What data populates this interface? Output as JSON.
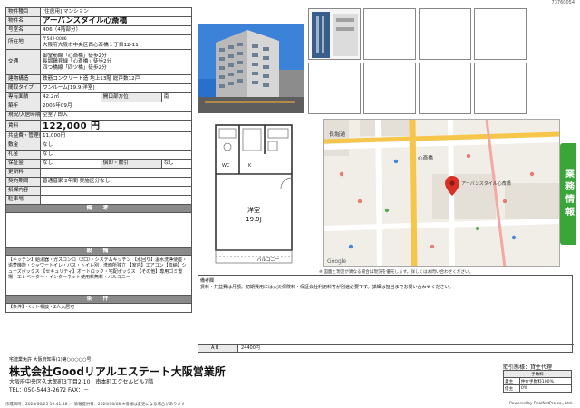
{
  "doc_id": "73760054",
  "spec": {
    "type_label": "物件種目",
    "type_value": "[住居用] マンション",
    "name_label": "物件名",
    "name_value": "アーバンスタイル心斎橋",
    "room_label": "号室名",
    "room_value": "406（4階部分）",
    "address_label": "所在地",
    "address_zip": "〒542-0086",
    "address_value": "大阪府大阪市中央区西心斎橋１丁目12-11",
    "traffic_label": "交通",
    "traffic_lines": [
      "御堂筋線「心斎橋」徒歩2分",
      "長堀鶴見緑「心斎橋」徒歩2分",
      "四つ橋線「四ツ橋」徒歩2分"
    ],
    "structure_label": "建物構造",
    "structure_value": "鉄筋コンクリート造 地上13階 総戸数12戸",
    "layout_label": "間取タイプ",
    "layout_value": "ワンルーム[19.9 洋室]",
    "area_label": "専有面積",
    "area_value": "42.2㎡",
    "direction_label": "開口部方位",
    "direction_value": "南",
    "built_label": "築年",
    "built_value": "2005年09月",
    "status_label": "現況/入居時期",
    "status_value": "空室 / 即入",
    "rent_label": "賃料",
    "rent_value": "122,000 円",
    "fee_label": "共益費・管理費",
    "fee_value": "11,000円",
    "deposit_label": "敷金",
    "deposit_value": "なし",
    "keymoney_label": "礼金",
    "keymoney_value": "なし",
    "guarantee_label": "保証金",
    "guarantee_value": "なし",
    "amort_label": "償却・敷引",
    "amort_value": "なし",
    "renewal_label": "更新料",
    "renewal_value": "",
    "contract_label": "契約期間",
    "contract_value": "普通借家 2年間 実施区分なし",
    "insurance_label": "損保内容",
    "insurance_value": "",
    "parking_label": "駐車場",
    "parking_value": "",
    "remarks_header": "備　考",
    "equipment_header": "設　備",
    "equipment_text": "【キッチン】給湯器・ガスコンロ（2口）・システムキッチン 【水回り】温水洗浄便座・追焚機能・シャワートイレ・バス・トイレ別・洗面所独立 【室内】エアコン【収納】シューズボックス 【セキュリティ】オートロック・宅配ボックス 【その他】専用ゴミ置場・エレベーター・インターネット使用料無料・バルコニー",
    "conditions_header": "条　件",
    "conditions_text": "【条件】ペット相談・2人入居可"
  },
  "map": {
    "labels": [
      "長堀通",
      "心斎橋",
      "アーバンスタイル心斎橋",
      "Google"
    ]
  },
  "floorplan": {
    "room_label": "洋室",
    "room_size": "19.9J",
    "balcony": "バルコニー"
  },
  "disclaimer": "※ 図面と現況が異なる場合は現況を優先します。詳しくはお問い合わせください。",
  "remarks": {
    "label": "備考欄",
    "text": "賃料・共益費は月額。初期費用には火災保険料・保証会社利用料等が別途必要です。詳細は担当までお問い合わせください。",
    "code_label": "A B",
    "code_value": "24400円"
  },
  "side_tab": "業務情報",
  "footer": {
    "license": "宅建業免許 大阪府知事(1)第○○○○○号",
    "company": "株式会社Goodリアルエステート大阪営業所",
    "address": "大阪府中央区久太郎町3丁目2-10　南本町エクセルビル7階",
    "tel": "TEL：050-5443-2672  FAX：－",
    "fine_print": "作成日時：2024/06/25 10:41:48  ／  情報提供日：2024/06/08  ※情報は変更になる場合があります",
    "powered": "Powered by RealNetPro co., Ltd.",
    "deal_label": "取引態様：貸主代理",
    "fee_header": "手数料",
    "fee_rows": [
      [
        "貸主",
        "仲介手数料100%"
      ],
      [
        "借主",
        "0%"
      ]
    ]
  }
}
